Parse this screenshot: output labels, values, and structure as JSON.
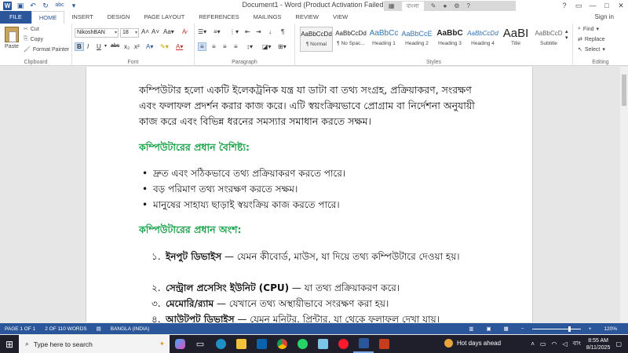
{
  "window": {
    "title": "Document1 - Word (Product Activation Failed)",
    "mini_toolbar_label": "বাংলা",
    "help": "?",
    "controls": [
      "—",
      "□",
      "✕"
    ]
  },
  "tabs": [
    "FILE",
    "HOME",
    "INSERT",
    "DESIGN",
    "PAGE LAYOUT",
    "REFERENCES",
    "MAILINGS",
    "REVIEW",
    "VIEW"
  ],
  "signin": "Sign in",
  "ribbon": {
    "clipboard": {
      "paste": "Paste",
      "cut": "Cut",
      "copy": "Copy",
      "format_painter": "Format Painter",
      "label": "Clipboard"
    },
    "font": {
      "name": "NikoshBAN",
      "size": "18",
      "label": "Font"
    },
    "paragraph": {
      "label": "Paragraph"
    },
    "styles": {
      "label": "Styles",
      "items": [
        {
          "preview": "AaBbCcDd",
          "name": "¶ Normal"
        },
        {
          "preview": "AaBbCcDd",
          "name": "¶ No Spac..."
        },
        {
          "preview": "AaBbCc",
          "name": "Heading 1"
        },
        {
          "preview": "AaBbCcE",
          "name": "Heading 2"
        },
        {
          "preview": "AaBbC",
          "name": "Heading 3"
        },
        {
          "preview": "AaBbCcDd",
          "name": "Heading 4"
        },
        {
          "preview": "AaBI",
          "name": "Title"
        },
        {
          "preview": "AaBbCcD",
          "name": "Subtitle"
        }
      ]
    },
    "editing": {
      "find": "Find",
      "replace": "Replace",
      "select": "Select",
      "label": "Editing"
    }
  },
  "document": {
    "intro": "কম্পিউটার হলো একটি ইলেকট্রনিক যন্ত্র যা ডাটা বা তথ্য সংগ্রহ, প্রক্রিয়াকরণ, সংরক্ষণ এবং ফলাফল প্রদর্শন করার কাজ করে। এটি স্বয়ংক্রিয়ভাবে প্রোগ্রাম বা নির্দেশনা অনুযায়ী কাজ করে এবং বিভিন্ন ধরনের সমস্যার সমাধান করতে সক্ষম।",
    "heading1": "কম্পিউটারের প্রধান বৈশিষ্ট্য:",
    "bullets": [
      "দ্রুত এবং সঠিকভাবে তথ্য প্রক্রিয়াকরণ করতে পারে।",
      "বড় পরিমাণ তথ্য সংরক্ষণ করতে সক্ষম।",
      "মানুষের সাহায্য ছাড়াই স্বয়ংক্রিয় কাজ করতে পারে।"
    ],
    "heading2": "কম্পিউটারের প্রধান অংশ:",
    "numbered": [
      {
        "n": "১.",
        "title": "ইনপুট ডিভাইস",
        "text": " — যেমন কীবোর্ড, মাউস, যা দিয়ে তথ্য কম্পিউটারে দেওয়া হয়।"
      },
      {
        "n": "২.",
        "title": "সেন্ট্রাল প্রসেসিং ইউনিট (CPU)",
        "text": " — যা তথ্য প্রক্রিয়াকরণ করে।"
      },
      {
        "n": "৩.",
        "title": "মেমোরি/র‍্যাম",
        "text": " — যেখানে তথ্য অস্থায়ীভাবে সংরক্ষণ করা হয়।"
      },
      {
        "n": "৪.",
        "title": "আউটপুট ডিভাইস",
        "text": " — যেমন মনিটর, প্রিন্টার, যা থেকে ফলাফল দেখা যায়।"
      }
    ]
  },
  "status": {
    "page": "PAGE 1 OF 1",
    "words": "2 OF 110 WORDS",
    "language": "BANGLA (INDIA)",
    "zoom": "120%"
  },
  "taskbar": {
    "search_placeholder": "Type here to search",
    "weather": "Hot days ahead",
    "language": "বাং",
    "time": "8:55 AM",
    "date": "8/11/2025"
  }
}
